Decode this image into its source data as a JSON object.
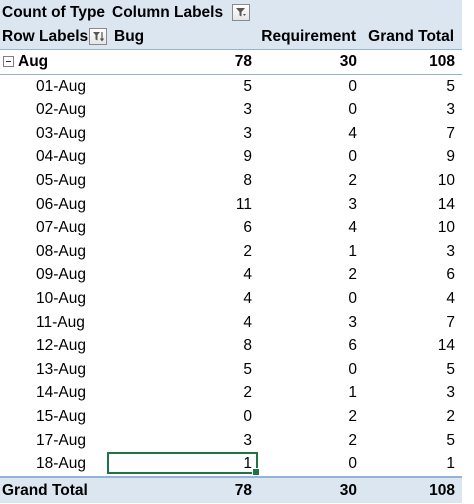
{
  "header": {
    "values_label": "Count of Type",
    "column_labels": "Column Labels",
    "row_labels": "Row Labels",
    "col_bug": "Bug",
    "col_requirement": "Requirement",
    "col_grand_total": "Grand Total"
  },
  "group": {
    "label": "Aug",
    "bug": "78",
    "requirement": "30",
    "total": "108"
  },
  "rows": [
    {
      "label": "01-Aug",
      "bug": "5",
      "requirement": "0",
      "total": "5"
    },
    {
      "label": "02-Aug",
      "bug": "3",
      "requirement": "0",
      "total": "3"
    },
    {
      "label": "03-Aug",
      "bug": "3",
      "requirement": "4",
      "total": "7"
    },
    {
      "label": "04-Aug",
      "bug": "9",
      "requirement": "0",
      "total": "9"
    },
    {
      "label": "05-Aug",
      "bug": "8",
      "requirement": "2",
      "total": "10"
    },
    {
      "label": "06-Aug",
      "bug": "11",
      "requirement": "3",
      "total": "14"
    },
    {
      "label": "07-Aug",
      "bug": "6",
      "requirement": "4",
      "total": "10"
    },
    {
      "label": "08-Aug",
      "bug": "2",
      "requirement": "1",
      "total": "3"
    },
    {
      "label": "09-Aug",
      "bug": "4",
      "requirement": "2",
      "total": "6"
    },
    {
      "label": "10-Aug",
      "bug": "4",
      "requirement": "0",
      "total": "4"
    },
    {
      "label": "11-Aug",
      "bug": "4",
      "requirement": "3",
      "total": "7"
    },
    {
      "label": "12-Aug",
      "bug": "8",
      "requirement": "6",
      "total": "14"
    },
    {
      "label": "13-Aug",
      "bug": "5",
      "requirement": "0",
      "total": "5"
    },
    {
      "label": "14-Aug",
      "bug": "2",
      "requirement": "1",
      "total": "3"
    },
    {
      "label": "15-Aug",
      "bug": "0",
      "requirement": "2",
      "total": "2"
    },
    {
      "label": "17-Aug",
      "bug": "3",
      "requirement": "2",
      "total": "5"
    },
    {
      "label": "18-Aug",
      "bug": "1",
      "requirement": "0",
      "total": "1"
    }
  ],
  "grand_total": {
    "label": "Grand Total",
    "bug": "78",
    "requirement": "30",
    "total": "108"
  },
  "colors": {
    "header_fill": "#dce6f1",
    "border": "#95b3d7",
    "selection": "#217346"
  },
  "icons": {
    "column_filter": "filter-icon",
    "row_filter": "filter-active-icon",
    "collapse": "collapse-minus-icon"
  }
}
